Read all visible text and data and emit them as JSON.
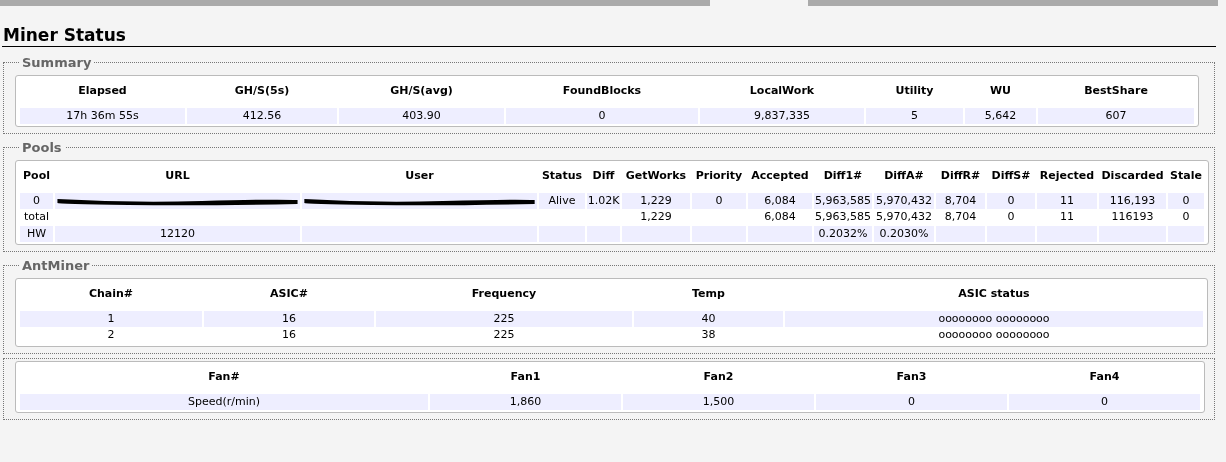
{
  "page_title": "Miner Status",
  "sections": [
    {
      "legend": "Summary",
      "columns": [
        "Elapsed",
        "GH/S(5s)",
        "GH/S(avg)",
        "FoundBlocks",
        "LocalWork",
        "Utility",
        "WU",
        "BestShare"
      ],
      "rows": [
        [
          "17h 36m 55s",
          "412.56",
          "403.90",
          "0",
          "9,837,335",
          "5",
          "5,642",
          "607"
        ]
      ]
    },
    {
      "legend": "Pools",
      "columns": [
        "Pool",
        "URL",
        "User",
        "Status",
        "Diff",
        "GetWorks",
        "Priority",
        "Accepted",
        "Diff1#",
        "DiffA#",
        "DiffR#",
        "DiffS#",
        "Rejected",
        "Discarded",
        "Stale"
      ],
      "rows": [
        [
          "0",
          {
            "redacted": true
          },
          {
            "redacted": true
          },
          "Alive",
          "1.02K",
          "1,229",
          "0",
          "6,084",
          "5,963,585",
          "5,970,432",
          "8,704",
          "0",
          "11",
          "116,193",
          "0"
        ],
        [
          "total",
          null,
          null,
          null,
          null,
          "1,229",
          null,
          "6,084",
          "5,963,585",
          "5,970,432",
          "8,704",
          "0",
          "11",
          "116193",
          "0"
        ],
        [
          "HW",
          "12120",
          null,
          null,
          null,
          null,
          null,
          null,
          "0.2032%",
          "0.2030%",
          null,
          null,
          null,
          null,
          null
        ]
      ]
    },
    {
      "legend": "AntMiner",
      "columns": [
        "Chain#",
        "ASIC#",
        "Frequency",
        "Temp",
        "ASIC status"
      ],
      "rows": [
        [
          "1",
          "16",
          "225",
          "40",
          "oooooooo oooooooo"
        ],
        [
          "2",
          "16",
          "225",
          "38",
          "oooooooo oooooooo"
        ]
      ]
    },
    {
      "columns": [
        "Fan#",
        "Fan1",
        "Fan2",
        "Fan3",
        "Fan4"
      ],
      "rows": [
        [
          "Speed(r/min)",
          "1,860",
          "1,500",
          "0",
          "0"
        ]
      ]
    }
  ]
}
